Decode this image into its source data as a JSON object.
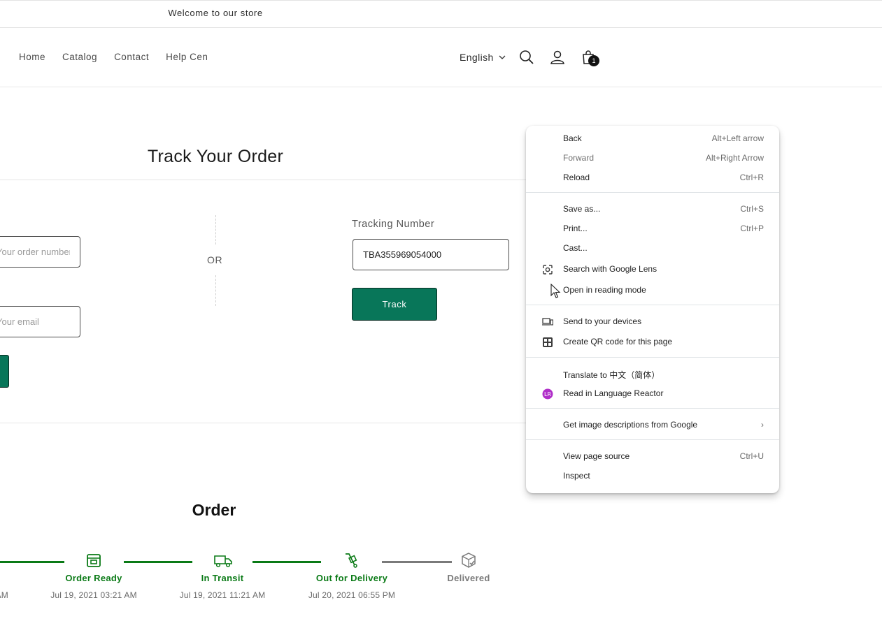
{
  "announcement": "Welcome to our store",
  "nav": [
    "Home",
    "Catalog",
    "Contact",
    "Help Cen"
  ],
  "header": {
    "language": "English",
    "cart_count": "1"
  },
  "track": {
    "title": "Track Your Order",
    "order_placeholder": "Your order number",
    "email_placeholder": "Your email",
    "or": "OR",
    "tracking_label": "Tracking Number",
    "tracking_value": "TBA355969054000",
    "track_button": "Track"
  },
  "order": {
    "title": "Order",
    "first_date_tail": "AM",
    "steps": [
      {
        "name": "Order Ready",
        "date": "Jul 19, 2021 03:21 AM",
        "status": "done"
      },
      {
        "name": "In Transit",
        "date": "Jul 19, 2021 11:21 AM",
        "status": "done"
      },
      {
        "name": "Out for Delivery",
        "date": "Jul 20, 2021 06:55 PM",
        "status": "done"
      },
      {
        "name": "Delivered",
        "date": "",
        "status": "pending"
      }
    ],
    "colors": {
      "done": "#0a7a16",
      "pending": "#7a7a7a"
    }
  },
  "context_menu": {
    "items": [
      {
        "label": "Back",
        "shortcut": "Alt+Left arrow"
      },
      {
        "label": "Forward",
        "shortcut": "Alt+Right Arrow"
      },
      {
        "label": "Reload",
        "shortcut": "Ctrl+R"
      },
      {
        "label": "Save as...",
        "shortcut": "Ctrl+S"
      },
      {
        "label": "Print...",
        "shortcut": "Ctrl+P"
      },
      {
        "label": "Cast...",
        "shortcut": ""
      },
      {
        "label": "Search with Google Lens",
        "shortcut": ""
      },
      {
        "label": "Open in reading mode",
        "shortcut": ""
      },
      {
        "label": "Send to your devices",
        "shortcut": ""
      },
      {
        "label": "Create QR code for this page",
        "shortcut": ""
      },
      {
        "label": "Translate to 中文（简体）",
        "shortcut": ""
      },
      {
        "label": "Read in Language Reactor",
        "shortcut": ""
      },
      {
        "label": "Get image descriptions from Google",
        "shortcut": "›"
      },
      {
        "label": "View page source",
        "shortcut": "Ctrl+U"
      },
      {
        "label": "Inspect",
        "shortcut": ""
      }
    ]
  }
}
